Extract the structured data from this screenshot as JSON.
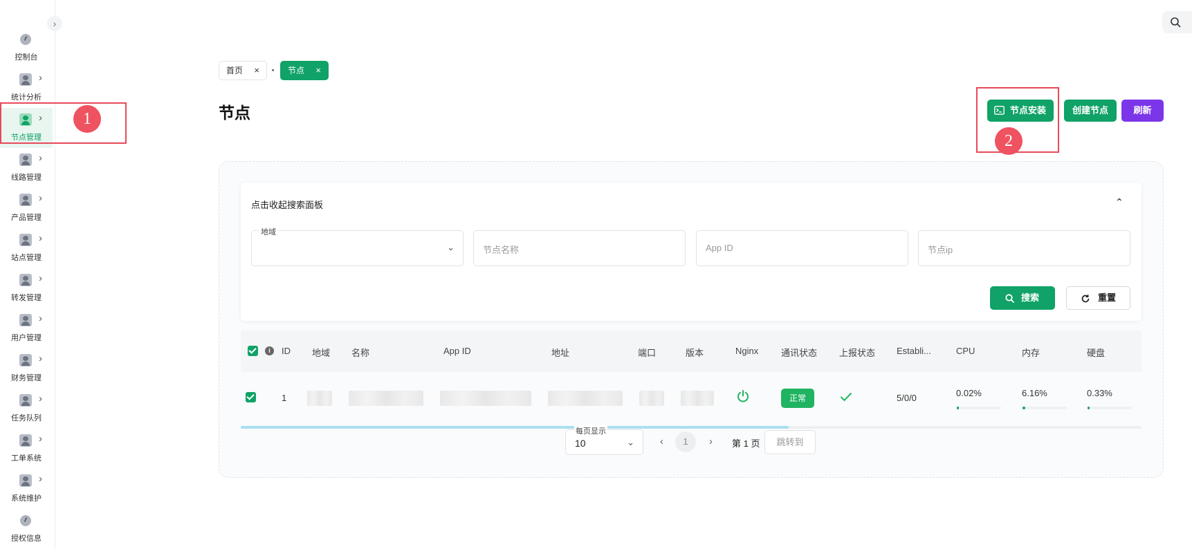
{
  "sidebar": {
    "toggle_glyph": "›",
    "items": [
      {
        "label": "控制台",
        "icon": "dashboard-icon"
      },
      {
        "label": "统计分析",
        "icon": "user-icon"
      },
      {
        "label": "节点管理",
        "icon": "user-icon",
        "active": true
      },
      {
        "label": "线路管理",
        "icon": "user-icon"
      },
      {
        "label": "产品管理",
        "icon": "user-icon"
      },
      {
        "label": "站点管理",
        "icon": "user-icon"
      },
      {
        "label": "转发管理",
        "icon": "user-icon"
      },
      {
        "label": "用户管理",
        "icon": "user-icon"
      },
      {
        "label": "财务管理",
        "icon": "user-icon"
      },
      {
        "label": "任务队列",
        "icon": "user-icon"
      },
      {
        "label": "工单系统",
        "icon": "user-icon"
      },
      {
        "label": "系统维护",
        "icon": "user-icon"
      },
      {
        "label": "授权信息",
        "icon": "dashboard-icon"
      }
    ],
    "chevron": "›"
  },
  "breadcrumb": {
    "tabs": [
      {
        "label": "首页"
      },
      {
        "label": "节点"
      }
    ],
    "close": "×"
  },
  "page": {
    "title": "节点"
  },
  "actions": {
    "install_label": "节点安装",
    "create_label": "创建节点",
    "refresh_label": "刷新"
  },
  "annotations": [
    "1",
    "2"
  ],
  "search": {
    "header": "点击收起搜索面板",
    "region_label": "地域",
    "name_placeholder": "节点名称",
    "appid_placeholder": "App ID",
    "ip_placeholder": "节点ip",
    "search_label": "搜索",
    "reset_label": "重置",
    "caret": "⌃",
    "dropdown": "⌄"
  },
  "table": {
    "columns": [
      "ID",
      "地域",
      "名称",
      "App ID",
      "地址",
      "端口",
      "版本",
      "Nginx",
      "通讯状态",
      "上报状态",
      "Establi...",
      "CPU",
      "内存",
      "硬盘"
    ],
    "row": {
      "id": "1",
      "comm_status": "正常",
      "established": "5/0/0",
      "cpu": "0.02%",
      "memory": "6.16%",
      "disk": "0.33%",
      "cpu_fraction": 0.0002,
      "memory_fraction": 0.0616,
      "disk_fraction": 0.0033
    }
  },
  "pagination": {
    "page_size_label": "每页显示",
    "page_size": "10",
    "prev": "‹",
    "next": "›",
    "current": "1",
    "page_text": "第 1 页",
    "jump_placeholder": "跳转到"
  },
  "colors": {
    "primary": "#10a267",
    "refresh": "#7c36ea",
    "annotation": "#e8495a",
    "status_ok": "#20b462"
  }
}
